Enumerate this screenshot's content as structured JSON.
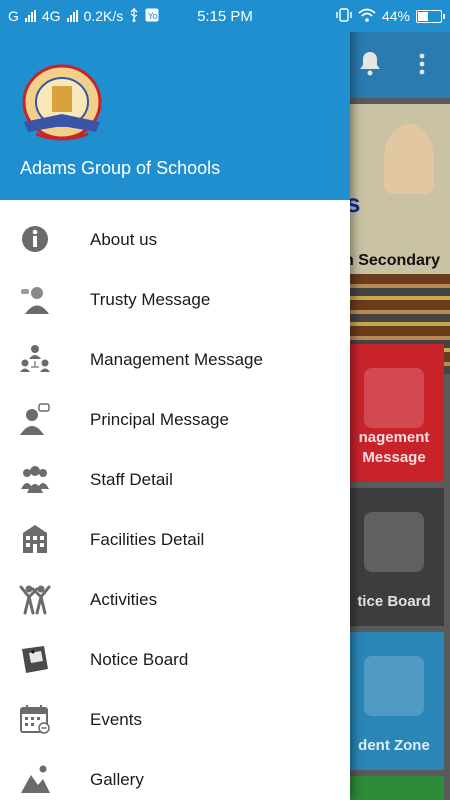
{
  "status_bar": {
    "network_left": "G",
    "network_right": "4G",
    "speed": "0.2K/s",
    "time": "5:15 PM",
    "battery": "44%",
    "battery_level": 0.44
  },
  "background": {
    "banner_text": "h Secondary",
    "banner_partial": "s",
    "tiles": [
      {
        "label": "nagement\nMessage",
        "color": "#c8232a"
      },
      {
        "label": "tice Board",
        "color": "#3d3d3d"
      },
      {
        "label": "dent Zone",
        "color": "#2a86b6"
      }
    ]
  },
  "drawer": {
    "title": "Adams Group of Schools",
    "menu_items": [
      {
        "label": "About us",
        "icon": "info-icon"
      },
      {
        "label": "Trusty Message",
        "icon": "trustee-icon"
      },
      {
        "label": "Management Message",
        "icon": "management-icon"
      },
      {
        "label": "Principal Message",
        "icon": "principal-icon"
      },
      {
        "label": "Staff Detail",
        "icon": "staff-icon"
      },
      {
        "label": "Facilities Detail",
        "icon": "building-icon"
      },
      {
        "label": "Activities",
        "icon": "activities-icon"
      },
      {
        "label": "Notice Board",
        "icon": "notice-icon"
      },
      {
        "label": "Events",
        "icon": "calendar-icon"
      },
      {
        "label": "Gallery",
        "icon": "gallery-icon"
      }
    ]
  },
  "colors": {
    "header_blue": "#1f8fd0",
    "icon_gray": "#6b6b6b"
  }
}
